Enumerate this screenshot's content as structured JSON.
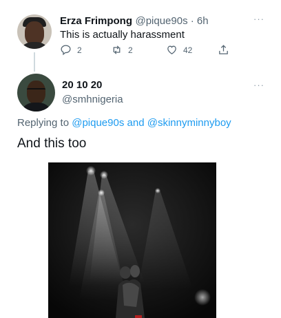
{
  "parent_tweet": {
    "author_name": "Erza Frimpong",
    "author_handle_time": "@pique90s · 6h",
    "text": "This is actually harassment",
    "more_icon": "more-horizontal-icon",
    "actions": {
      "reply_count": "2",
      "retweet_count": "2",
      "like_count": "42",
      "reply_icon": "reply-icon",
      "retweet_icon": "retweet-icon",
      "like_icon": "heart-icon",
      "share_icon": "share-icon"
    }
  },
  "reply_tweet": {
    "author_name": "20 10 20",
    "author_handle": "@smhnigeria",
    "replying_prefix": "Replying to",
    "replying_user_1": "@pique90s",
    "replying_and": "and",
    "replying_user_2": "@skinnyminnyboy",
    "text": "And this too",
    "more_icon": "more-horizontal-icon"
  },
  "colors": {
    "link": "#1d9bf0",
    "secondary_text": "#536471",
    "primary_text": "#0f1419"
  }
}
